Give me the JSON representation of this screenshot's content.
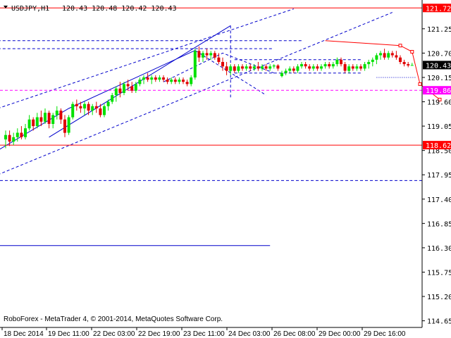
{
  "header": {
    "symbol": "USDJPY,H1",
    "quote": "120.43 120.48 120.42 120.43"
  },
  "footer": {
    "copyright": "RoboForex - MetaTrader 4, © 2001-2014, MetaQuotes Software Corp."
  },
  "colors": {
    "background": "#ffffff",
    "candle_up": "#00e000",
    "candle_down": "#e00000",
    "trend": "#0000cc",
    "level": "#ff0000",
    "pivot": "#ff00ff",
    "price_tag": "#000000"
  },
  "chart_data": {
    "type": "candlestick",
    "ylim": [
      114.5,
      121.9
    ],
    "x_range": [
      "18 Dec 2014",
      "30 Dec 2014"
    ],
    "grid": false,
    "y_ticks": [
      "121.25",
      "120.70",
      "120.15",
      "119.60",
      "119.05",
      "118.50",
      "117.95",
      "117.40",
      "116.85",
      "116.30",
      "115.75",
      "115.20",
      "114.65"
    ],
    "x_ticks": [
      "18 Dec 2014",
      "19 Dec 11:00",
      "22 Dec 03:00",
      "22 Dec 19:00",
      "23 Dec 11:00",
      "24 Dec 03:00",
      "26 Dec 08:00",
      "29 Dec 00:00",
      "29 Dec 16:00"
    ],
    "price_tags": [
      {
        "label": "121.72",
        "value": 121.72,
        "kind": "level"
      },
      {
        "label": "120.43",
        "value": 120.43,
        "kind": "current"
      },
      {
        "label": "119.86",
        "value": 119.86,
        "kind": "pivot"
      },
      {
        "label": "118.62",
        "value": 118.62,
        "kind": "level"
      }
    ],
    "horizontal_levels": [
      {
        "value": 121.72,
        "style": "solid",
        "color": "level"
      },
      {
        "value": 119.86,
        "style": "dashed",
        "color": "pivot"
      },
      {
        "value": 118.62,
        "style": "solid",
        "color": "level"
      },
      {
        "value": 117.82,
        "style": "dashed",
        "color": "trend"
      }
    ],
    "candles": [
      [
        118.75,
        118.95,
        118.55,
        118.85
      ],
      [
        118.85,
        118.95,
        118.6,
        118.7
      ],
      [
        118.7,
        118.9,
        118.62,
        118.8
      ],
      [
        118.8,
        119.0,
        118.7,
        118.9
      ],
      [
        118.9,
        119.05,
        118.75,
        118.8
      ],
      [
        118.8,
        119.1,
        118.75,
        119.0
      ],
      [
        119.0,
        119.3,
        118.95,
        119.2
      ],
      [
        119.2,
        119.25,
        118.95,
        119.05
      ],
      [
        119.05,
        119.35,
        119.0,
        119.25
      ],
      [
        119.25,
        119.4,
        119.05,
        119.15
      ],
      [
        119.15,
        119.45,
        119.1,
        119.35
      ],
      [
        119.35,
        119.4,
        119.0,
        119.1
      ],
      [
        119.1,
        119.35,
        119.0,
        119.3
      ],
      [
        119.3,
        119.5,
        119.2,
        119.4
      ],
      [
        119.4,
        119.45,
        119.1,
        119.2
      ],
      [
        119.2,
        119.3,
        118.8,
        118.9
      ],
      [
        118.9,
        119.3,
        118.85,
        119.25
      ],
      [
        119.25,
        119.6,
        119.2,
        119.55
      ],
      [
        119.55,
        119.65,
        119.4,
        119.5
      ],
      [
        119.5,
        119.6,
        119.35,
        119.45
      ],
      [
        119.45,
        119.6,
        119.3,
        119.55
      ],
      [
        119.55,
        119.6,
        119.3,
        119.4
      ],
      [
        119.4,
        119.55,
        119.3,
        119.5
      ],
      [
        119.5,
        119.6,
        119.35,
        119.45
      ],
      [
        119.45,
        119.55,
        119.25,
        119.3
      ],
      [
        119.3,
        119.55,
        119.25,
        119.5
      ],
      [
        119.5,
        119.65,
        119.4,
        119.6
      ],
      [
        119.6,
        119.8,
        119.55,
        119.75
      ],
      [
        119.75,
        119.95,
        119.6,
        119.9
      ],
      [
        119.9,
        120.05,
        119.7,
        119.8
      ],
      [
        119.8,
        120.05,
        119.75,
        120.0
      ],
      [
        120.0,
        120.1,
        119.85,
        119.95
      ],
      [
        119.95,
        120.05,
        119.8,
        119.85
      ],
      [
        119.85,
        120.05,
        119.8,
        120.0
      ],
      [
        120.0,
        120.15,
        119.95,
        120.1
      ],
      [
        120.1,
        120.2,
        120.0,
        120.15
      ],
      [
        120.15,
        120.25,
        120.05,
        120.1
      ],
      [
        120.1,
        120.2,
        120.0,
        120.15
      ],
      [
        120.15,
        120.2,
        120.05,
        120.1
      ],
      [
        120.1,
        120.2,
        120.05,
        120.15
      ],
      [
        120.15,
        120.2,
        120.05,
        120.1
      ],
      [
        120.1,
        120.15,
        120.0,
        120.05
      ],
      [
        120.05,
        120.15,
        120.0,
        120.1
      ],
      [
        120.1,
        120.15,
        120.0,
        120.05
      ],
      [
        120.05,
        120.15,
        120.0,
        120.1
      ],
      [
        120.1,
        120.15,
        120.0,
        120.05
      ],
      [
        120.05,
        120.1,
        119.95,
        120.0
      ],
      [
        120.0,
        120.2,
        119.95,
        120.15
      ],
      [
        120.15,
        120.8,
        120.1,
        120.75
      ],
      [
        120.75,
        120.85,
        120.5,
        120.6
      ],
      [
        120.6,
        120.75,
        120.5,
        120.7
      ],
      [
        120.7,
        120.8,
        120.55,
        120.65
      ],
      [
        120.65,
        120.75,
        120.55,
        120.7
      ],
      [
        120.7,
        120.75,
        120.55,
        120.6
      ],
      [
        120.6,
        120.7,
        120.45,
        120.5
      ],
      [
        120.5,
        120.6,
        120.3,
        120.4
      ],
      [
        120.4,
        120.5,
        120.2,
        120.3
      ],
      [
        120.3,
        120.45,
        120.2,
        120.4
      ],
      [
        120.4,
        120.45,
        120.25,
        120.3
      ],
      [
        120.3,
        120.45,
        120.25,
        120.4
      ],
      [
        120.4,
        120.45,
        120.3,
        120.35
      ],
      [
        120.35,
        120.45,
        120.3,
        120.4
      ],
      [
        120.4,
        120.45,
        120.3,
        120.35
      ],
      [
        120.35,
        120.45,
        120.3,
        120.4
      ],
      [
        120.4,
        120.5,
        120.3,
        120.35
      ],
      [
        120.35,
        120.45,
        120.3,
        120.4
      ],
      [
        120.4,
        120.45,
        120.3,
        120.35
      ],
      [
        120.35,
        120.45,
        120.3,
        120.4
      ],
      [
        120.4,
        120.45,
        120.35,
        120.42
      ],
      [
        120.42,
        120.45,
        120.3,
        120.35
      ],
      [
        120.18,
        120.3,
        120.15,
        120.25
      ],
      [
        120.25,
        120.35,
        120.2,
        120.3
      ],
      [
        120.3,
        120.4,
        120.25,
        120.35
      ],
      [
        120.35,
        120.4,
        120.25,
        120.3
      ],
      [
        120.3,
        120.45,
        120.25,
        120.4
      ],
      [
        120.4,
        120.5,
        120.35,
        120.45
      ],
      [
        120.45,
        120.5,
        120.35,
        120.4
      ],
      [
        120.4,
        120.45,
        120.3,
        120.35
      ],
      [
        120.35,
        120.45,
        120.3,
        120.4
      ],
      [
        120.4,
        120.45,
        120.3,
        120.35
      ],
      [
        120.35,
        120.45,
        120.3,
        120.4
      ],
      [
        120.4,
        120.5,
        120.35,
        120.45
      ],
      [
        120.45,
        120.5,
        120.35,
        120.4
      ],
      [
        120.4,
        120.5,
        120.35,
        120.45
      ],
      [
        120.45,
        120.6,
        120.4,
        120.55
      ],
      [
        120.55,
        120.6,
        120.4,
        120.45
      ],
      [
        120.45,
        120.5,
        120.25,
        120.3
      ],
      [
        120.3,
        120.45,
        120.25,
        120.4
      ],
      [
        120.4,
        120.45,
        120.3,
        120.35
      ],
      [
        120.35,
        120.45,
        120.3,
        120.4
      ],
      [
        120.4,
        120.45,
        120.3,
        120.35
      ],
      [
        120.35,
        120.5,
        120.3,
        120.45
      ],
      [
        120.45,
        120.55,
        120.35,
        120.5
      ],
      [
        120.5,
        120.6,
        120.4,
        120.55
      ],
      [
        120.55,
        120.7,
        120.45,
        120.65
      ],
      [
        120.65,
        120.75,
        120.55,
        120.7
      ],
      [
        120.7,
        120.8,
        120.55,
        120.6
      ],
      [
        120.6,
        120.75,
        120.55,
        120.7
      ],
      [
        120.7,
        120.75,
        120.6,
        120.65
      ],
      [
        120.65,
        120.75,
        120.55,
        120.6
      ],
      [
        120.6,
        120.65,
        120.45,
        120.5
      ],
      [
        120.5,
        120.55,
        120.4,
        120.45
      ],
      [
        120.45,
        120.5,
        120.38,
        120.42
      ],
      [
        120.43,
        120.48,
        120.42,
        120.43
      ]
    ],
    "projection_lines": [
      {
        "points": [
          [
            81,
            120.98
          ],
          [
            100,
            120.87
          ],
          [
            103,
            120.73
          ],
          [
            105,
            120.0
          ],
          [
            110,
            119.65
          ]
        ],
        "color": "level",
        "style": "solid"
      }
    ],
    "drawings": [
      {
        "points": [
          [
            -2,
            118.5
          ],
          [
            16,
            119.45
          ],
          [
            48,
            120.76
          ]
        ],
        "color": "trend",
        "style": "solid"
      },
      {
        "points": [
          [
            11,
            118.8
          ],
          [
            57,
            121.32
          ]
        ],
        "color": "trend",
        "style": "solid"
      },
      {
        "points": [
          [
            -2,
            117.95
          ],
          [
            98,
            121.62
          ]
        ],
        "color": "trend",
        "style": "dashed"
      },
      {
        "points": [
          [
            -2,
            119.45
          ],
          [
            73,
            121.7
          ]
        ],
        "color": "trend",
        "style": "dashed"
      },
      {
        "points": [
          [
            -2,
            120.98
          ],
          [
            75,
            120.98
          ]
        ],
        "color": "trend",
        "style": "dashed"
      },
      {
        "points": [
          [
            -2,
            120.8
          ],
          [
            68,
            120.8
          ]
        ],
        "color": "trend",
        "style": "dashed"
      },
      {
        "points": [
          [
            48,
            120.76
          ],
          [
            66,
            119.75
          ]
        ],
        "color": "trend",
        "style": "dashed"
      },
      {
        "points": [
          [
            40,
            120.05
          ],
          [
            55,
            120.7
          ],
          [
            68,
            120.25
          ]
        ],
        "color": "trend",
        "style": "dashed"
      },
      {
        "points": [
          [
            -2,
            116.35
          ],
          [
            67,
            116.35
          ]
        ],
        "color": "trend",
        "style": "solid"
      },
      {
        "points": [
          [
            57,
            121.32
          ],
          [
            57,
            119.7
          ]
        ],
        "color": "trend",
        "style": "dashed"
      },
      {
        "points": [
          [
            58,
            120.55
          ],
          [
            90,
            120.55
          ]
        ],
        "color": "trend",
        "style": "dashed"
      },
      {
        "points": [
          [
            58,
            120.25
          ],
          [
            90,
            120.25
          ]
        ],
        "color": "trend",
        "style": "dashed"
      },
      {
        "points": [
          [
            94,
            120.15
          ],
          [
            104,
            120.15
          ]
        ],
        "color": "trend",
        "style": "dotted"
      }
    ]
  }
}
